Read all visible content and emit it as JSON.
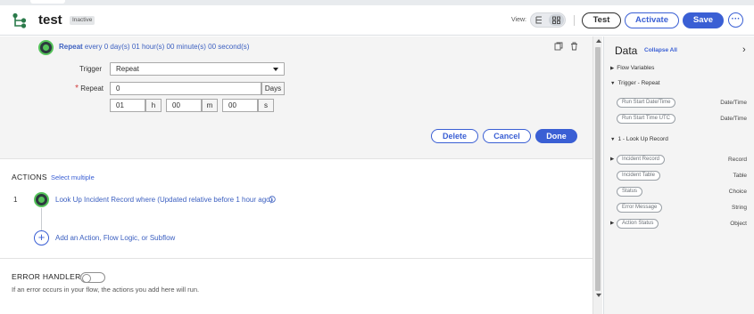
{
  "tab": {
    "title": "test"
  },
  "header": {
    "flow_name": "test",
    "status": "Inactive",
    "view_label": "View:",
    "test_label": "Test",
    "activate_label": "Activate",
    "save_label": "Save",
    "more_label": "···"
  },
  "trigger": {
    "summary_bold": "Repeat",
    "summary_rest": " every 0 day(s) 01 hour(s) 00 minute(s) 00 second(s)",
    "trigger_label": "Trigger",
    "trigger_value": "Repeat",
    "repeat_label": "Repeat",
    "repeat_days_value": "0",
    "days_unit": "Days",
    "hours_value": "01",
    "hours_unit": "h",
    "minutes_value": "00",
    "minutes_unit": "m",
    "seconds_value": "00",
    "seconds_unit": "s",
    "delete_label": "Delete",
    "cancel_label": "Cancel",
    "done_label": "Done"
  },
  "actions": {
    "heading": "ACTIONS",
    "select_multiple": "Select multiple",
    "steps": [
      {
        "number": "1",
        "label": "Look Up Incident Record where (Updated relative before 1 hour ago)"
      }
    ],
    "add_label": "Add an Action, Flow Logic, or Subflow"
  },
  "error_handler": {
    "title": "ERROR HANDLER",
    "help": "If an error occurs in your flow, the actions you add here will run."
  },
  "data_panel": {
    "title": "Data",
    "collapse_all": "Collapse All",
    "sections": [
      {
        "label": "Flow Variables",
        "expanded": false
      },
      {
        "label": "Trigger - Repeat",
        "expanded": true
      },
      {
        "label": "1 - Look Up Record",
        "expanded": true
      }
    ],
    "trigger_pills": [
      {
        "label": "Run Start Date/Time",
        "type": "Date/Time"
      },
      {
        "label": "Run Start Time UTC",
        "type": "Date/Time"
      }
    ],
    "lookup_pills": [
      {
        "label": "Incident Record",
        "type": "Record",
        "expandable": true
      },
      {
        "label": "Incident Table",
        "type": "Table",
        "expandable": false
      },
      {
        "label": "Status",
        "type": "Choice",
        "expandable": false
      },
      {
        "label": "Error Message",
        "type": "String",
        "expandable": false
      },
      {
        "label": "Action Status",
        "type": "Object",
        "expandable": true
      }
    ]
  },
  "colors": {
    "accent": "#3a5fd4",
    "link": "#3b5fc0",
    "step_ring": "#55c45a",
    "required": "#d23c3c"
  }
}
